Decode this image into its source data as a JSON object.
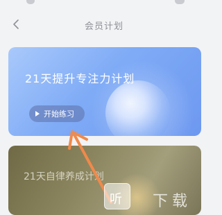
{
  "nav": {
    "title": "会员计划"
  },
  "plans": [
    {
      "title": "21天提升专注力计划",
      "button_label": "开始练习"
    },
    {
      "title": "21天自律养成计划"
    }
  ],
  "watermark": {
    "char": "听",
    "text": "下载"
  },
  "colors": {
    "card_blue": "#7fabf6",
    "arrow": "#f08a4b",
    "background": "#f2f3f5"
  },
  "icons": {
    "back": "chevron-left-icon",
    "play": "play-icon"
  }
}
